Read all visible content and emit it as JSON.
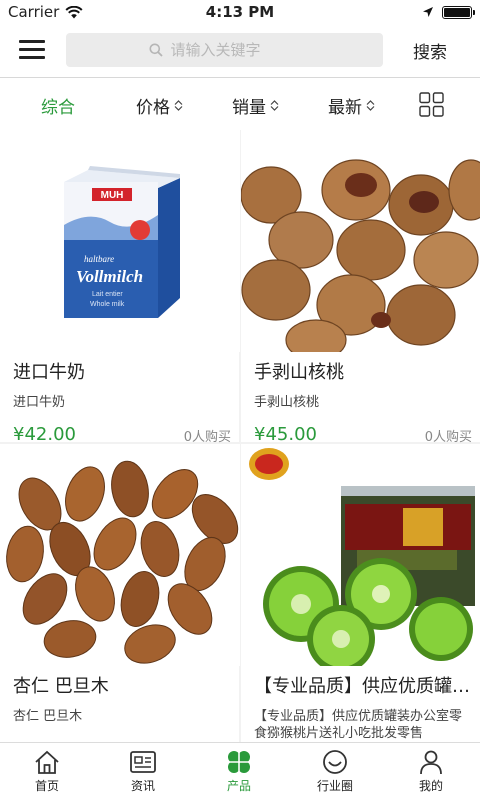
{
  "status": {
    "carrier": "Carrier",
    "time": "4:13 PM"
  },
  "header": {
    "search_placeholder": "请输入关键字",
    "search_label": "搜索"
  },
  "sort": {
    "items": [
      {
        "label": "综合",
        "active": true
      },
      {
        "label": "价格"
      },
      {
        "label": "销量"
      },
      {
        "label": "最新"
      }
    ]
  },
  "products": [
    {
      "title": "进口牛奶",
      "subtitle": "进口牛奶",
      "price": "¥42.00",
      "sold": "0人购买"
    },
    {
      "title": "手剥山核桃",
      "subtitle": "手剥山核桃",
      "price": "¥45.00",
      "sold": "0人购买"
    },
    {
      "title": "杏仁  巴旦木",
      "subtitle": "杏仁  巴旦木",
      "price": "",
      "sold": ""
    },
    {
      "title": "【专业品质】供应优质罐装办公室零食猕猴桃片送礼小吃批发零售",
      "subtitle": "【专业品质】供应优质罐装办公室零食猕猴桃片送礼小吃批发零售",
      "price": "",
      "sold": ""
    }
  ],
  "tabs": [
    {
      "label": "首页"
    },
    {
      "label": "资讯"
    },
    {
      "label": "产品",
      "active": true
    },
    {
      "label": "行业圈"
    },
    {
      "label": "我的"
    }
  ],
  "colors": {
    "accent": "#2a9a3b"
  }
}
